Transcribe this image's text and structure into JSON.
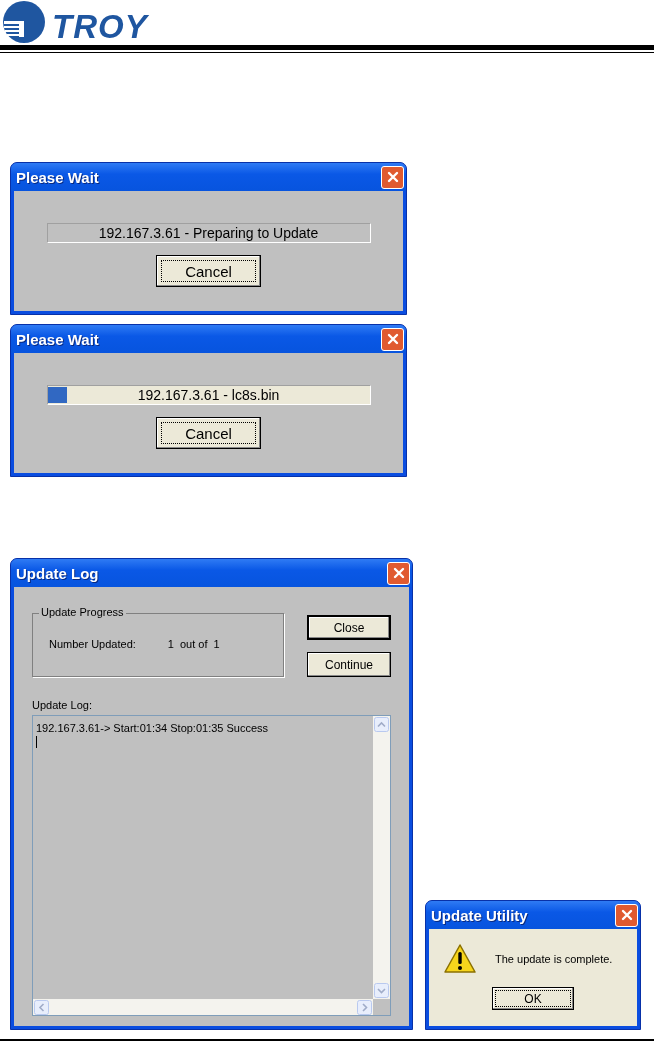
{
  "header": {
    "logo_text": "TROY"
  },
  "dialogs": [
    {
      "kind": "status",
      "title": "Please Wait",
      "status": "192.167.3.61 - Preparing to Update",
      "button": "Cancel"
    },
    {
      "kind": "progress",
      "title": "Please Wait",
      "status": "192.167.3.61 - lc8s.bin",
      "level": 0.06,
      "button": "Cancel"
    }
  ],
  "update_log": {
    "title": "Update Log",
    "group_title": "Update Progress",
    "number_label": "Number Updated:",
    "count": "1",
    "out_of": "out of",
    "total": "1",
    "buttons": [
      "Close",
      "Continue"
    ],
    "log_label": "Update Log:",
    "log_lines": [
      "192.167.3.61-> Start:01:34 Stop:01:35  Success"
    ]
  },
  "message_box": {
    "title": "Update Utility",
    "message": "The update is complete.",
    "button": "OK"
  }
}
